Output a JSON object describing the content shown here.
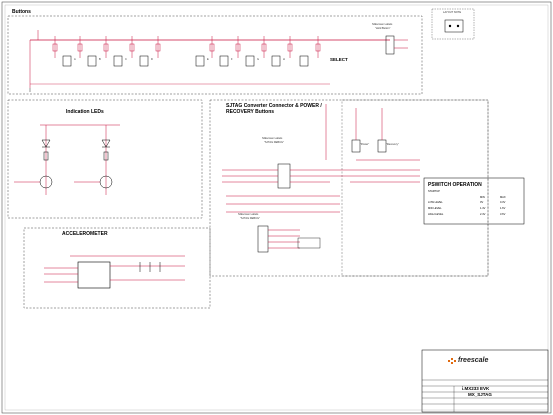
{
  "sheet": {
    "colors": {
      "wire": "#c8103e",
      "line": "#000000",
      "border": "#555555",
      "dash": "#444444",
      "logo": "#e06a10"
    }
  },
  "sections": {
    "buttons": {
      "title": "Buttons"
    },
    "leds": {
      "title": "Indication LEDs"
    },
    "sjtag": {
      "title_line1": "SJTAG Converter Connector & POWER /",
      "title_line2": "RECOVERY Buttons"
    },
    "accelerometer": {
      "title": "ACCELEROMETER"
    },
    "switch_op": {
      "title": "PSWITCH OPERATION"
    }
  },
  "buttons": {
    "labels": [
      "A",
      "B",
      "C",
      "D",
      "E",
      "F",
      "G",
      "H"
    ],
    "select_label": "SELECT",
    "callout": [
      "Silkscreen Labels",
      "\"Hold Button\""
    ]
  },
  "sjtag": {
    "callout1": [
      "Silkscreen Labels",
      "\"SJTAG DEBUG\""
    ],
    "callout2": [
      "Silkscreen Labels",
      "\"SJTAG DEBUG\""
    ],
    "power_label": "\"Power\"",
    "recovery_label": "\"Recovery\""
  },
  "switch_table": {
    "headers": [
      "",
      "MIN",
      "MAX"
    ],
    "rows": [
      [
        "STARTUP",
        "",
        ""
      ],
      [
        "LOW LEVEL",
        "0V",
        "0.3V"
      ],
      [
        "MID LEVEL",
        "1.4V",
        "1.6V"
      ],
      [
        "HIGH LEVEL",
        "2.4V",
        "3.6V"
      ]
    ]
  },
  "layout_note": {
    "title": "LAYOUT NOTE"
  },
  "title_block": {
    "brand": "freescale",
    "board": "i.MX233 EVK",
    "sheet": "MX_SJTAG"
  }
}
